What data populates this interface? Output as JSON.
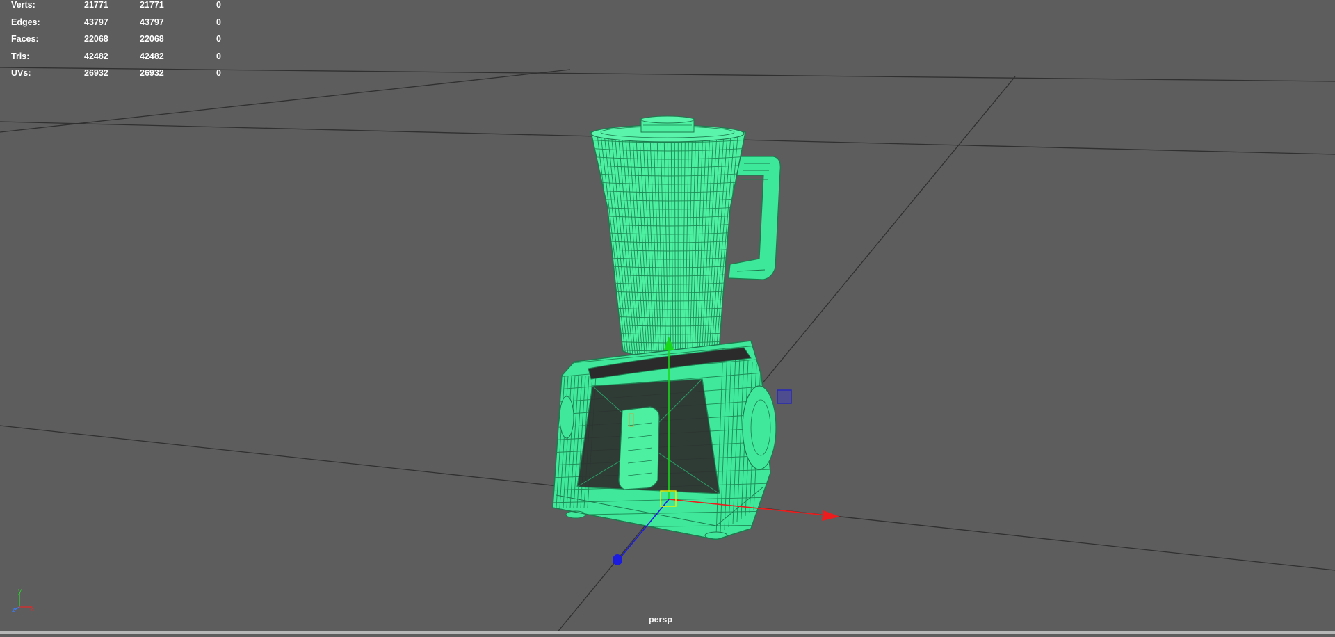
{
  "hud": {
    "rows": [
      {
        "label": "Verts:",
        "selected": "21771",
        "total": "21771",
        "selection": "0"
      },
      {
        "label": "Edges:",
        "selected": "43797",
        "total": "43797",
        "selection": "0"
      },
      {
        "label": "Faces:",
        "selected": "22068",
        "total": "22068",
        "selection": "0"
      },
      {
        "label": "Tris:",
        "selected": "42482",
        "total": "42482",
        "selection": "0"
      },
      {
        "label": "UVs:",
        "selected": "26932",
        "total": "26932",
        "selection": "0"
      }
    ]
  },
  "viewport": {
    "camera_name": "persp",
    "background_color": "#5d5d5d",
    "grid_color": "#2e2e2e",
    "wireframe_color": "#49f29f"
  },
  "axis_indicator": {
    "x_label": "x",
    "y_label": "y",
    "z_label": "z"
  },
  "manipulator": {
    "x_color": "#ee1c1c",
    "y_color": "#19d819",
    "z_color": "#1c1ce0"
  },
  "icons": [
    "view-axis-icon",
    "move-manipulator-icon",
    "pivot-icon"
  ]
}
